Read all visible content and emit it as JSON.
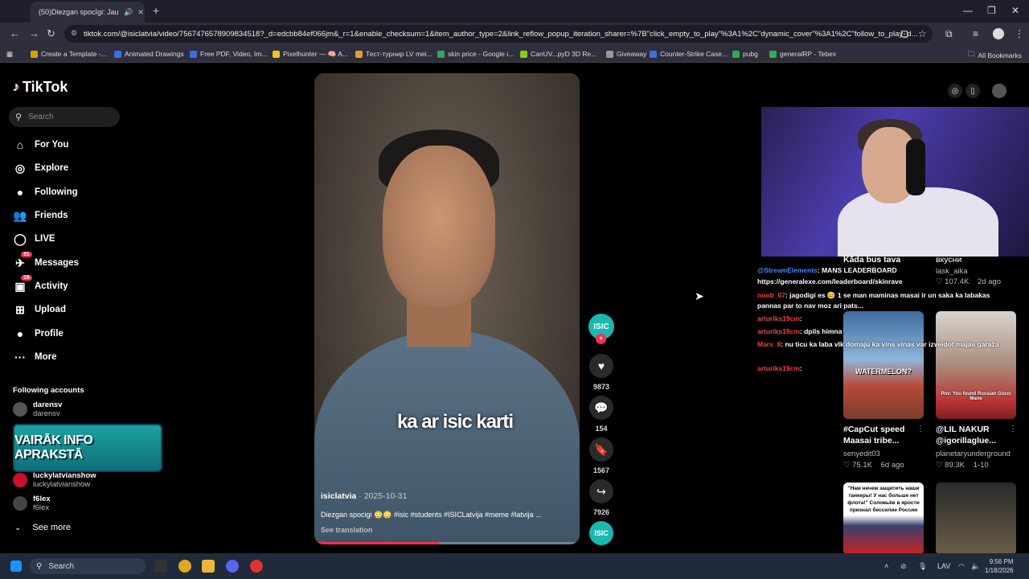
{
  "browser": {
    "tab_title": "(50)Diezgan spocīgi: Jautri",
    "url": "tiktok.com/@isiclatvia/video/7567476578909834518?_d=edcbb84ef066jm&_r=1&enable_checksum=1&item_author_type=2&link_reflow_popup_iteration_sharer=%7B\"click_empty_to_play\"%3A1%2C\"dynamic_cover\"%3A1%2C\"follow_to_play_d...",
    "bookmarks": [
      {
        "label": "Create a Template -...",
        "color": "#d6a200"
      },
      {
        "label": "Animated Drawings",
        "color": "#3b6fe0"
      },
      {
        "label": "Free PDF, Video, Im...",
        "color": "#3b6fe0"
      },
      {
        "label": "Pixelhunter — 🧠 A...",
        "color": "#f0c419"
      },
      {
        "label": "Тест-турнир LV mei...",
        "color": "#e0a030"
      },
      {
        "label": "skin price - Google i...",
        "color": "#2faa55"
      },
      {
        "label": "CanUV...pyD 3D Re...",
        "color": "#88cc22"
      },
      {
        "label": "Giveaway",
        "color": "#999"
      },
      {
        "label": "Counter-Strike Case...",
        "color": "#3b6fe0"
      },
      {
        "label": "pubg",
        "color": "#2faa55"
      },
      {
        "label": "generalRP - Tebex",
        "color": "#2faa55"
      }
    ],
    "all_bookmarks": "All Bookmarks"
  },
  "sidebar": {
    "logo": "TikTok",
    "search_placeholder": "Search",
    "nav": [
      {
        "label": "For You",
        "icon": "home-icon",
        "glyph": "⌂"
      },
      {
        "label": "Explore",
        "icon": "compass-icon",
        "glyph": "◎"
      },
      {
        "label": "Following",
        "icon": "following-icon",
        "glyph": "●"
      },
      {
        "label": "Friends",
        "icon": "friends-icon",
        "glyph": "👥"
      },
      {
        "label": "LIVE",
        "icon": "live-icon",
        "glyph": "◯"
      },
      {
        "label": "Messages",
        "icon": "messages-icon",
        "glyph": "✈",
        "badge": "31"
      },
      {
        "label": "Activity",
        "icon": "activity-icon",
        "glyph": "▣",
        "badge": "19"
      },
      {
        "label": "Upload",
        "icon": "upload-icon",
        "glyph": "⊞"
      },
      {
        "label": "Profile",
        "icon": "profile-icon",
        "glyph": "●"
      },
      {
        "label": "More",
        "icon": "more-icon",
        "glyph": "···"
      }
    ],
    "following_title": "Following accounts",
    "accounts": [
      {
        "name": "darensv",
        "handle": "darensv",
        "color": "#555"
      },
      {
        "name": "luckylatvianshow",
        "handle": "luckylatvianshow",
        "color": "#c8102e"
      },
      {
        "name": "f6lex",
        "handle": "f6lex",
        "color": "#444"
      }
    ],
    "see_more": "See more",
    "promo_banner": "VAIRĀK INFO APRAKSTĀ"
  },
  "video": {
    "caption": "ka ar isic karti",
    "author": "isiclatvia",
    "date": "· 2025-10-31",
    "description": "Diezgan spocigi 😳😳 #isic #students #ISICLatvija #meme #latvija ...",
    "see_translation": "See translation",
    "progress_fraction": 0.47
  },
  "rail": {
    "avatar_text": "ISIC",
    "likes": "9873",
    "comments": "154",
    "saves": "1567",
    "shares": "7926"
  },
  "chat": [
    {
      "user": "@StreamElements",
      "text": ": MANS LEADERBOARD"
    },
    {
      "user": "",
      "text": "https://generalexe.com/leaderboard/skinrave"
    },
    {
      "user": "noob_07",
      "text": ": jagodigi es 😐 1 se man maminas masai ir un saka ka labakas"
    },
    {
      "user": "",
      "text": "pannas par to nav moz ari pats..."
    },
    {
      "user": "arturiks19cm",
      "text": ":"
    },
    {
      "user": "arturiks19cm",
      "text": ": dpils himna"
    },
    {
      "user": "Marx_8",
      "text": ": nu ticu ka laba vlk domaju ka vins vinas var izveidot majas garaža"
    },
    {
      "user": "arturiks19cm",
      "text": ":"
    }
  ],
  "recommendations": [
    {
      "title": "Kāda bus tava",
      "user": "",
      "stat": "",
      "ago": ""
    },
    {
      "title": "вкусни",
      "user": "lask_aika",
      "stat": "107.4K",
      "ago": "2d ago"
    },
    {
      "title": "#CapCut speed Maasai tribe...",
      "user": "senyedit03",
      "stat": "75.1K",
      "ago": "6d ago",
      "thumb_text": "WATERMELON?"
    },
    {
      "title": "@LIL NAKUR @igorillaglue...",
      "user": "planetaryunderground",
      "stat": "89.3K",
      "ago": "1-10",
      "thumb_text": "Pov: You found Russian Gucci Mane"
    },
    {
      "title": "",
      "user": "",
      "stat": "",
      "ago": "",
      "thumb_text": "\"Нам нечем защитить наши танкеры! У нас больше нет флота!\" Соловьёв в ярости признал бессилие России"
    }
  ],
  "taskbar": {
    "search": "Search",
    "lang": "LAV",
    "time": "9:56 PM",
    "date": "1/18/2026"
  },
  "colors": {
    "accent": "#fe2c55",
    "isic": "#19b8b1"
  }
}
